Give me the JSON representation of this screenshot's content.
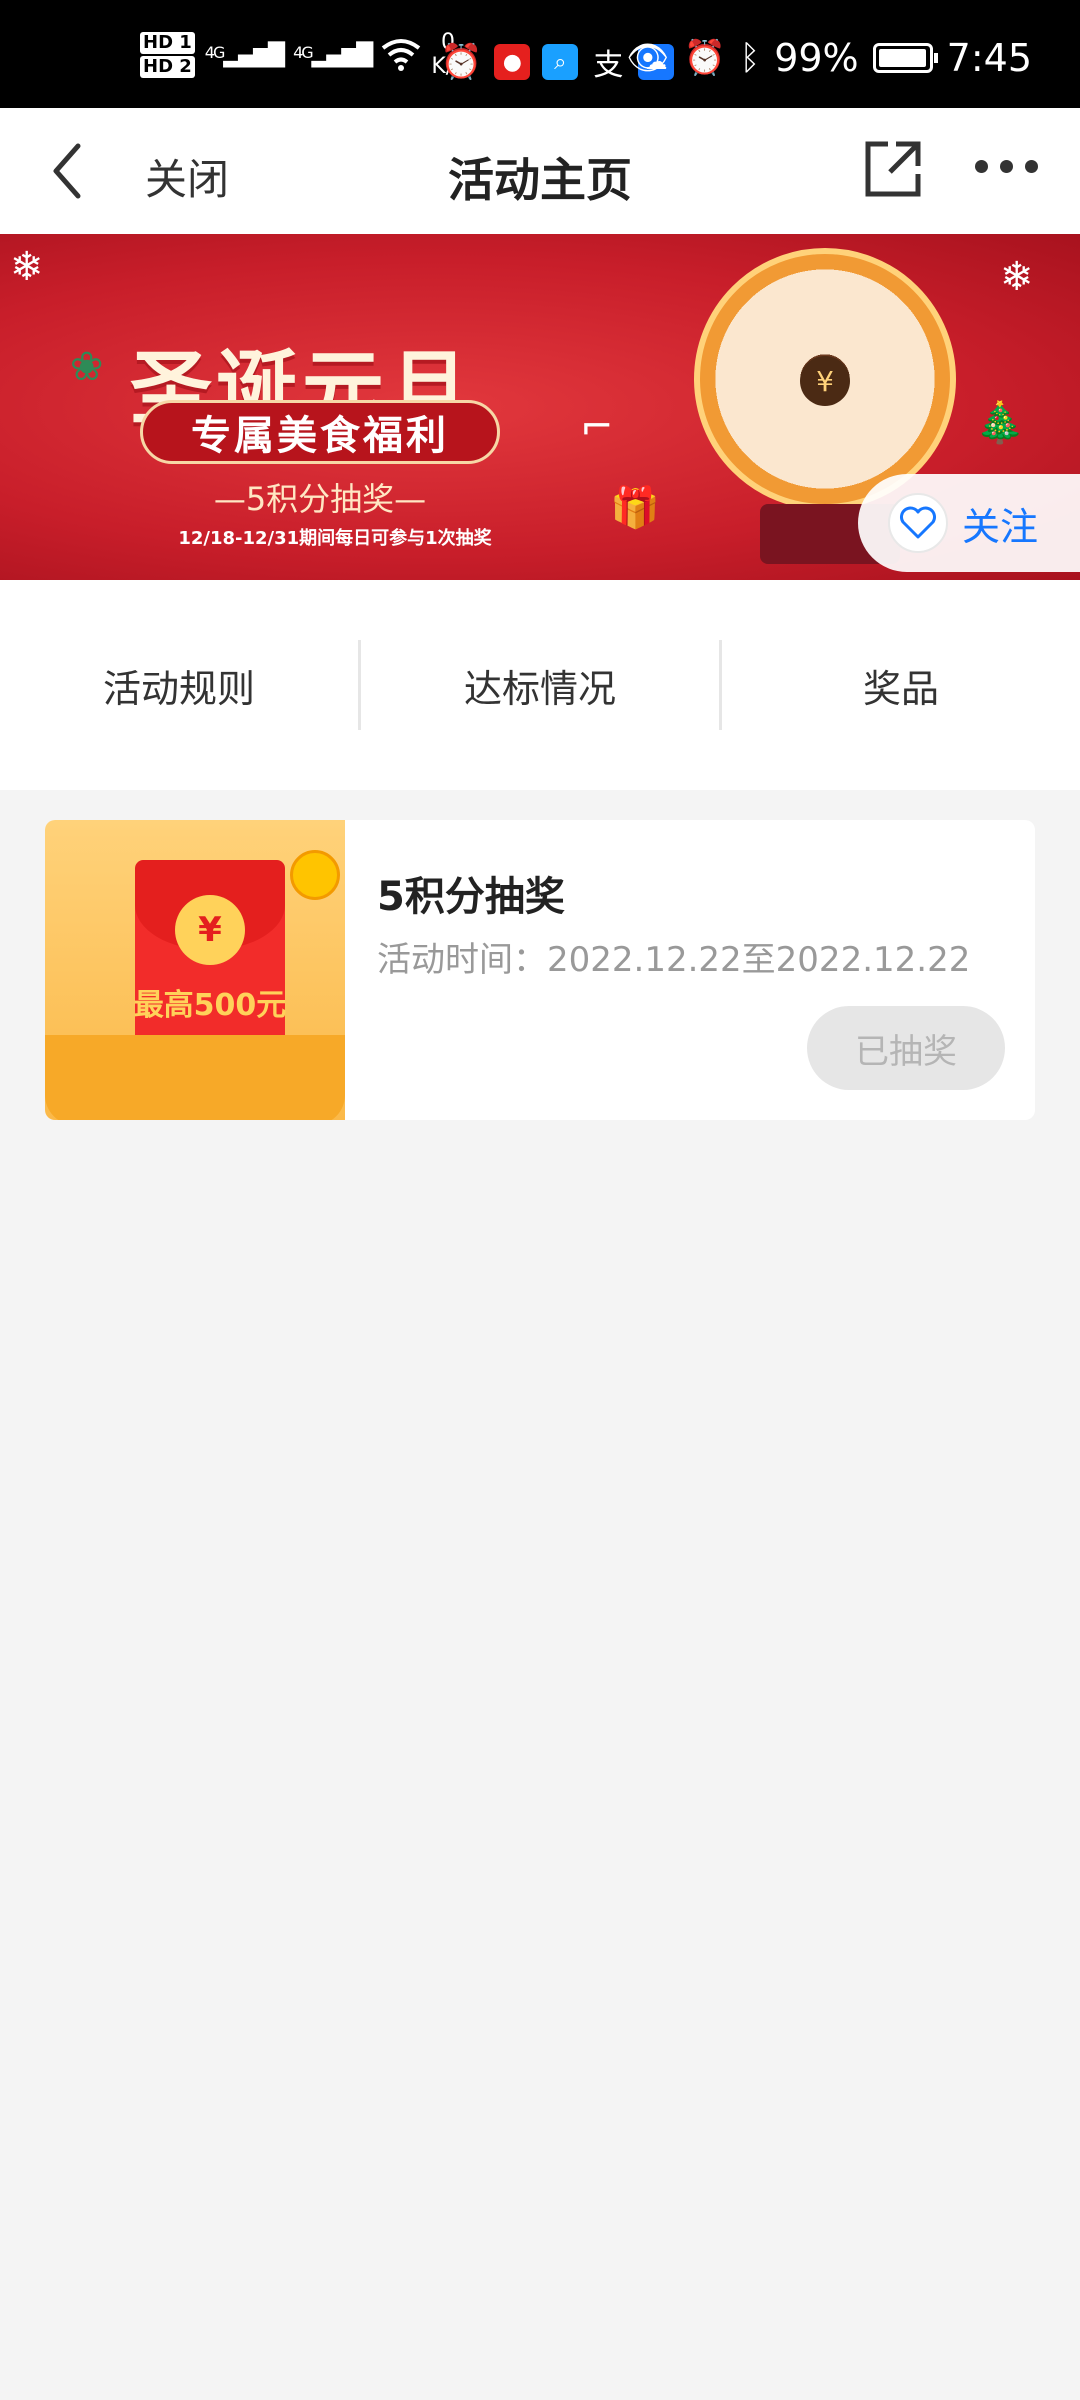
{
  "status_bar": {
    "hd1": "HD 1",
    "hd2": "HD 2",
    "net1": "4G",
    "net2": "4G",
    "speed_value": "0",
    "speed_unit": "K/s",
    "battery_percent": "99%",
    "battery_level": 0.99,
    "time": "7:45"
  },
  "header": {
    "close_label": "关闭",
    "title": "活动主页"
  },
  "banner": {
    "title": "圣诞元旦",
    "subtitle": "专属美食福利",
    "tagline": "—5积分抽奖—",
    "date_text": "12/18-12/31期间每日可参与1次抽奖",
    "wheel_center": "¥",
    "follow_label": "关注"
  },
  "tabs": [
    {
      "label": "活动规则"
    },
    {
      "label": "达标情况"
    },
    {
      "label": "奖品"
    }
  ],
  "activity_card": {
    "thumb_coin": "¥",
    "thumb_text": "最高500元",
    "title": "5积分抽奖",
    "time_text": "活动时间：2022.12.22至2022.12.22",
    "button_label": "已抽奖"
  }
}
